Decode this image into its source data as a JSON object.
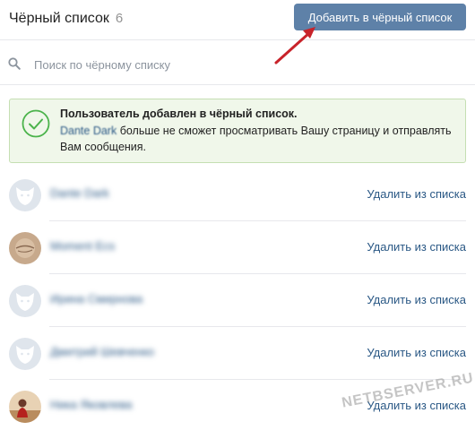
{
  "header": {
    "title": "Чёрный список",
    "count": "6",
    "add_button_label": "Добавить в чёрный список"
  },
  "search": {
    "placeholder": "Поиск по чёрному списку",
    "value": ""
  },
  "notice": {
    "title": "Пользователь добавлен в чёрный список.",
    "user_name": "Dante Dark",
    "message": " больше не сможет просматривать Вашу страницу и отправлять Вам сообщения."
  },
  "users": [
    {
      "name": "Dante Dark",
      "action": "Удалить из списка",
      "avatar": "default"
    },
    {
      "name": "Moment Ecs",
      "action": "Удалить из списка",
      "avatar": "photo-brown"
    },
    {
      "name": "Ирина Смирнова",
      "action": "Удалить из списка",
      "avatar": "default"
    },
    {
      "name": "Дмитрий Шевченко",
      "action": "Удалить из списка",
      "avatar": "default"
    },
    {
      "name": "Ника Яковлева",
      "action": "Удалить из списка",
      "avatar": "photo-red"
    }
  ],
  "watermark": "NETBSERVER.RU",
  "colors": {
    "accent": "#5e81a8",
    "link": "#2a5885",
    "success_bg": "#f0f7ea",
    "success_border": "#c5dfb2",
    "check": "#4bb34b",
    "arrow": "#c8232a"
  },
  "icons": {
    "search": "search-icon",
    "check": "check-circle-icon",
    "arrow": "red-arrow-annotation"
  }
}
